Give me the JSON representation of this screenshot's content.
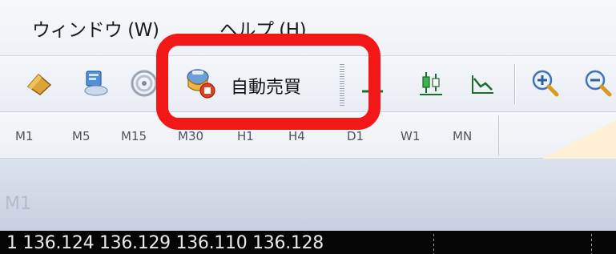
{
  "menu": {
    "window_label": "ウィンドウ (W)",
    "help_label": "ヘルプ (H)"
  },
  "toolbar": {
    "autotrade_label": "自動売買",
    "icons": [
      "eraser-icon",
      "navigator-icon",
      "signal-icon",
      "auto-trading-icon",
      "crosshair-icon",
      "candlestick-icon",
      "line-chart-icon",
      "zoom-in-icon",
      "zoom-out-icon"
    ]
  },
  "timeframes": [
    "M1",
    "M5",
    "M15",
    "M30",
    "H1",
    "H4",
    "D1",
    "W1",
    "MN"
  ],
  "chart": {
    "caption": "M1",
    "quote_line": "1 136.124 136.129 136.110 136.128"
  },
  "colors": {
    "highlight": "#f31818",
    "quote_background": "#050505",
    "wedge": "#fdf0d6"
  }
}
